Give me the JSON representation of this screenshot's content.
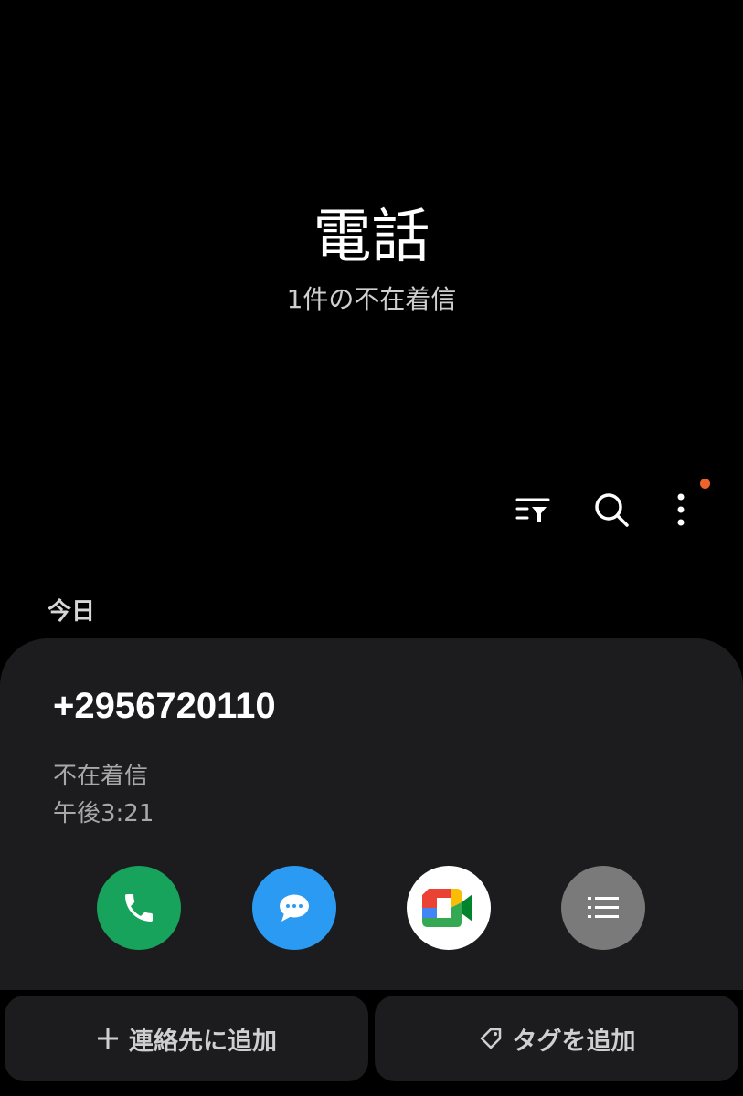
{
  "header": {
    "title": "電話",
    "subtitle": "1件の不在着信"
  },
  "toolbar": {
    "icons": [
      "filter-icon",
      "search-icon",
      "more-options-icon"
    ],
    "has_notification_dot": true
  },
  "call_log": {
    "section_label": "今日",
    "entry": {
      "number": "+2956720110",
      "type": "不在着信",
      "time": "午後3:21"
    },
    "actions": [
      "phone-icon",
      "message-icon",
      "google-meet-icon",
      "details-icon"
    ]
  },
  "bottom_actions": {
    "add_contact": "連絡先に追加",
    "add_tag": "タグを追加"
  },
  "colors": {
    "background": "#000000",
    "card": "#1c1c1e",
    "call_green": "#17a35b",
    "message_blue": "#2b9af3",
    "details_gray": "#7a7a7a",
    "notification_orange": "#f0622b"
  }
}
